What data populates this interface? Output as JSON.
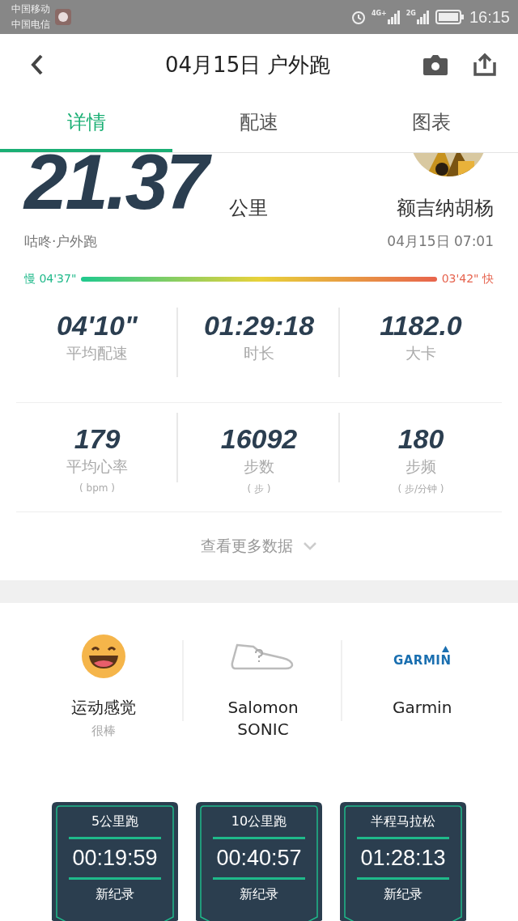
{
  "status_bar": {
    "carriers": [
      "中国移动",
      "中国电信"
    ],
    "network_labels": [
      "4G+",
      "2G"
    ],
    "time": "16:15"
  },
  "header": {
    "title": "04月15日 户外跑"
  },
  "tabs": [
    {
      "label": "详情",
      "selected": true
    },
    {
      "label": "配速",
      "selected": false
    },
    {
      "label": "图表",
      "selected": false
    }
  ],
  "run": {
    "distance": "21.37",
    "unit": "公里",
    "source": "咕咚·户外跑",
    "user_name": "额吉纳胡杨",
    "datetime": "04月15日 07:01",
    "pace_slow": "慢 04'37\"",
    "pace_fast": "03'42\" 快"
  },
  "stats": [
    {
      "value": "04'10\"",
      "label": "平均配速"
    },
    {
      "value": "01:29:18",
      "label": "时长"
    },
    {
      "value": "1182.0",
      "label": "大卡"
    },
    {
      "value": "179",
      "label": "平均心率",
      "unit": "( bpm )"
    },
    {
      "value": "16092",
      "label": "步数",
      "unit": "( 步 )"
    },
    {
      "value": "180",
      "label": "步频",
      "unit": "( 步/分钟 )"
    }
  ],
  "more_button": "查看更多数据",
  "gear": [
    {
      "kind": "feeling",
      "label": "运动感觉",
      "sublabel": "很棒"
    },
    {
      "kind": "shoe",
      "label": "Salomon SONIC"
    },
    {
      "kind": "device",
      "logo_text": "GARMIN",
      "label": "Garmin"
    }
  ],
  "records": [
    {
      "title": "5公里跑",
      "time": "00:19:59",
      "note": "新纪录"
    },
    {
      "title": "10公里跑",
      "time": "00:40:57",
      "note": "新纪录"
    },
    {
      "title": "半程马拉松",
      "time": "01:28:13",
      "note": "新纪录"
    }
  ]
}
